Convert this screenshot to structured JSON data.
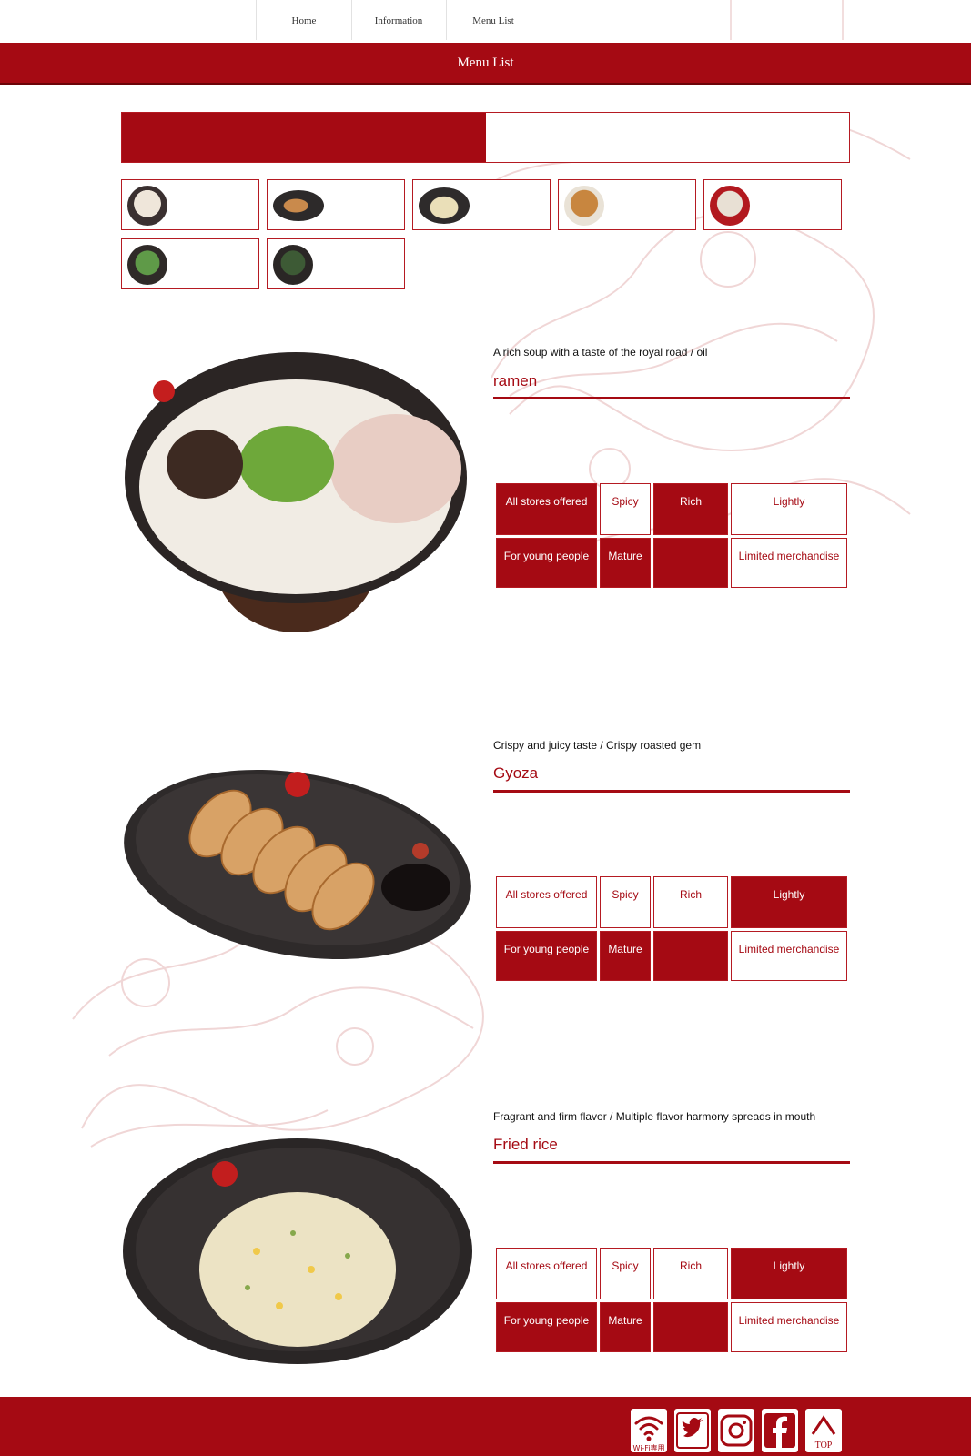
{
  "nav": {
    "items": [
      {
        "label": "Home"
      },
      {
        "label": "Information"
      },
      {
        "label": "Menu List"
      }
    ]
  },
  "page_title": "Menu List",
  "thumbnails": [
    {
      "name": "ramen-thumb"
    },
    {
      "name": "gyoza-thumb"
    },
    {
      "name": "fried-rice-thumb"
    },
    {
      "name": "spicy-ramen-thumb"
    },
    {
      "name": "red-bowl-ramen-thumb"
    },
    {
      "name": "green-topping-bowl-thumb"
    },
    {
      "name": "seaweed-topping-bowl-thumb"
    }
  ],
  "tag_labels": {
    "all_stores": "All stores offered",
    "spicy": "Spicy",
    "rich": "Rich",
    "lightly": "Lightly",
    "young": "For young people",
    "mature": "Mature",
    "blank": "",
    "limited": "Limited merchandise"
  },
  "items": [
    {
      "subtitle": "A rich soup with a taste of the royal road / oil",
      "title": "ramen",
      "dish": "ramen bowl",
      "tags_on": {
        "all_stores": true,
        "spicy": false,
        "rich": true,
        "lightly": false,
        "young": true,
        "mature": true,
        "blank": true,
        "limited": false
      }
    },
    {
      "subtitle": "Crispy and juicy taste / Crispy roasted gem",
      "title": "Gyoza",
      "dish": "gyoza plate",
      "tags_on": {
        "all_stores": false,
        "spicy": false,
        "rich": false,
        "lightly": true,
        "young": true,
        "mature": true,
        "blank": true,
        "limited": false
      }
    },
    {
      "subtitle": "Fragrant and firm flavor / Multiple flavor harmony spreads in mouth",
      "title": "Fried rice",
      "dish": "fried rice plate",
      "tags_on": {
        "all_stores": false,
        "spicy": false,
        "rich": false,
        "lightly": true,
        "young": true,
        "mature": true,
        "blank": true,
        "limited": false
      }
    }
  ],
  "footer": {
    "icons": [
      "wifi-icon",
      "twitter-icon",
      "instagram-icon",
      "facebook-icon",
      "top-icon"
    ],
    "wifi_label": "Wi-Fi専用",
    "top_label": "TOP"
  },
  "colors": {
    "brand": "#a50a13",
    "brand_dark": "#6b0408",
    "dragon": "#f3dcdc"
  }
}
